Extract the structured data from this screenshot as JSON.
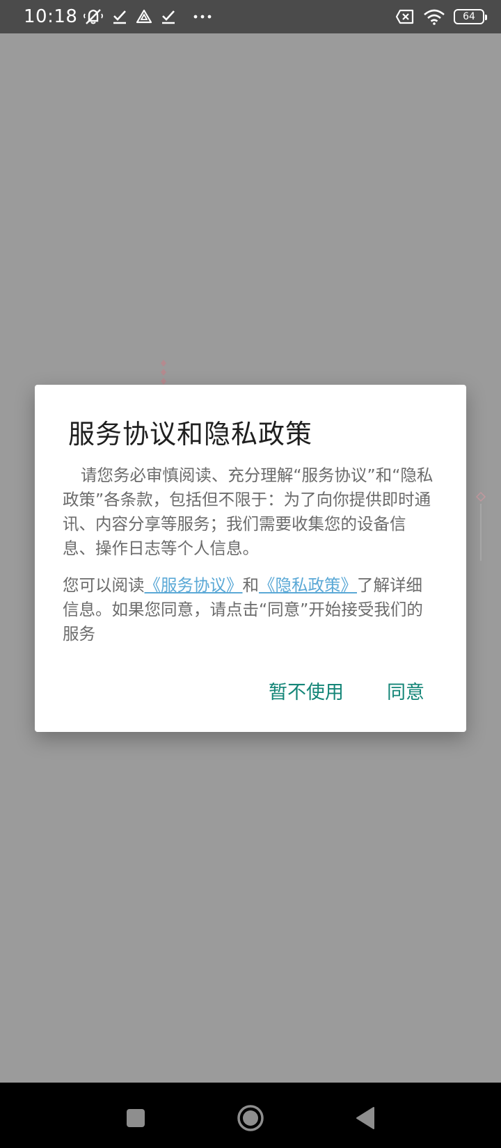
{
  "status_bar": {
    "time": "10:18",
    "battery_level": "64",
    "icons_left": [
      "muted-bell-icon",
      "check-icon",
      "triangle-warning-icon",
      "check-icon",
      "more-dots-icon"
    ],
    "icons_right": [
      "no-sim-icon",
      "wifi-icon",
      "battery-icon"
    ]
  },
  "dialog": {
    "title": "服务协议和隐私政策",
    "paragraph_1": "请您务必审慎阅读、充分理解“服务协议”和“隐私政策”各条款，包括但不限于：为了向你提供即时通讯、内容分享等服务；我们需要收集您的设备信息、操作日志等个人信息。",
    "paragraph_2_before": "您可以阅读",
    "link_service_agreement": "《服务协议》",
    "paragraph_2_middle": "和",
    "link_privacy_policy": "《隐私政策》",
    "paragraph_2_after": "了解详细信息。如果您同意，请点击“同意”开始接受我们的服务",
    "decline_label": "暂不使用",
    "agree_label": "同意"
  },
  "nav_bar": {
    "buttons": [
      "recent-apps-icon",
      "home-icon",
      "back-icon"
    ]
  },
  "colors": {
    "status_bar_bg": "#4b4b4b",
    "scrim": "#9b9b9b",
    "dialog_bg": "#ffffff",
    "accent": "#138577",
    "link": "#5aa8d6",
    "body_text": "#6b6b6b",
    "title_text": "#1f1f1f",
    "nav_bar_bg": "#000000"
  }
}
